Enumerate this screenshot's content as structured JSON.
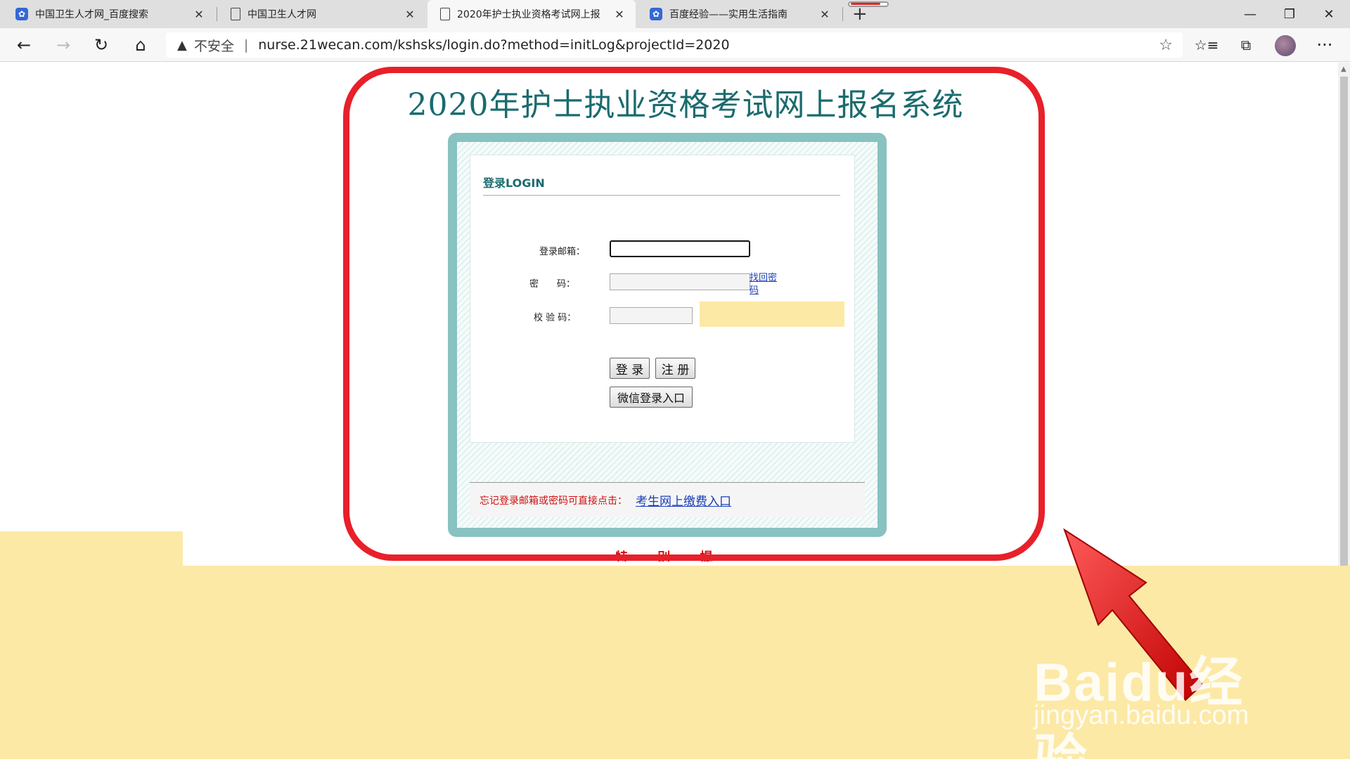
{
  "browser": {
    "tabs": [
      {
        "title": "中国卫生人才网_百度搜索",
        "icon": "baidu-paw-icon"
      },
      {
        "title": "中国卫生人才网",
        "icon": "document-icon"
      },
      {
        "title": "2020年护士执业资格考试网上报",
        "icon": "document-icon"
      },
      {
        "title": "百度经验——实用生活指南",
        "icon": "baidu-paw-icon"
      }
    ],
    "new_tab": "+",
    "insecure_label": "不安全",
    "url": "nurse.21wecan.com/kshsks/login.do?method=initLog&projectId=2020"
  },
  "page": {
    "system_title": "2020年护士执业资格考试网上报名系统",
    "login_heading": "登录LOGIN",
    "email_label": "登录邮箱：",
    "password_label": "密　　码：",
    "captcha_label": "校 验 码：",
    "forgot_link": "找回密码",
    "login_button": "登 录",
    "register_button": "注 册",
    "wechat_button": "微信登录入口",
    "forgot_note": "忘记登录邮箱或密码可直接点击：",
    "pay_link": "考生网上缴费入口",
    "special_notice": "特 别 提 示"
  },
  "watermark": {
    "brand": "Baidu经验",
    "site": "jingyan.baidu.com"
  }
}
